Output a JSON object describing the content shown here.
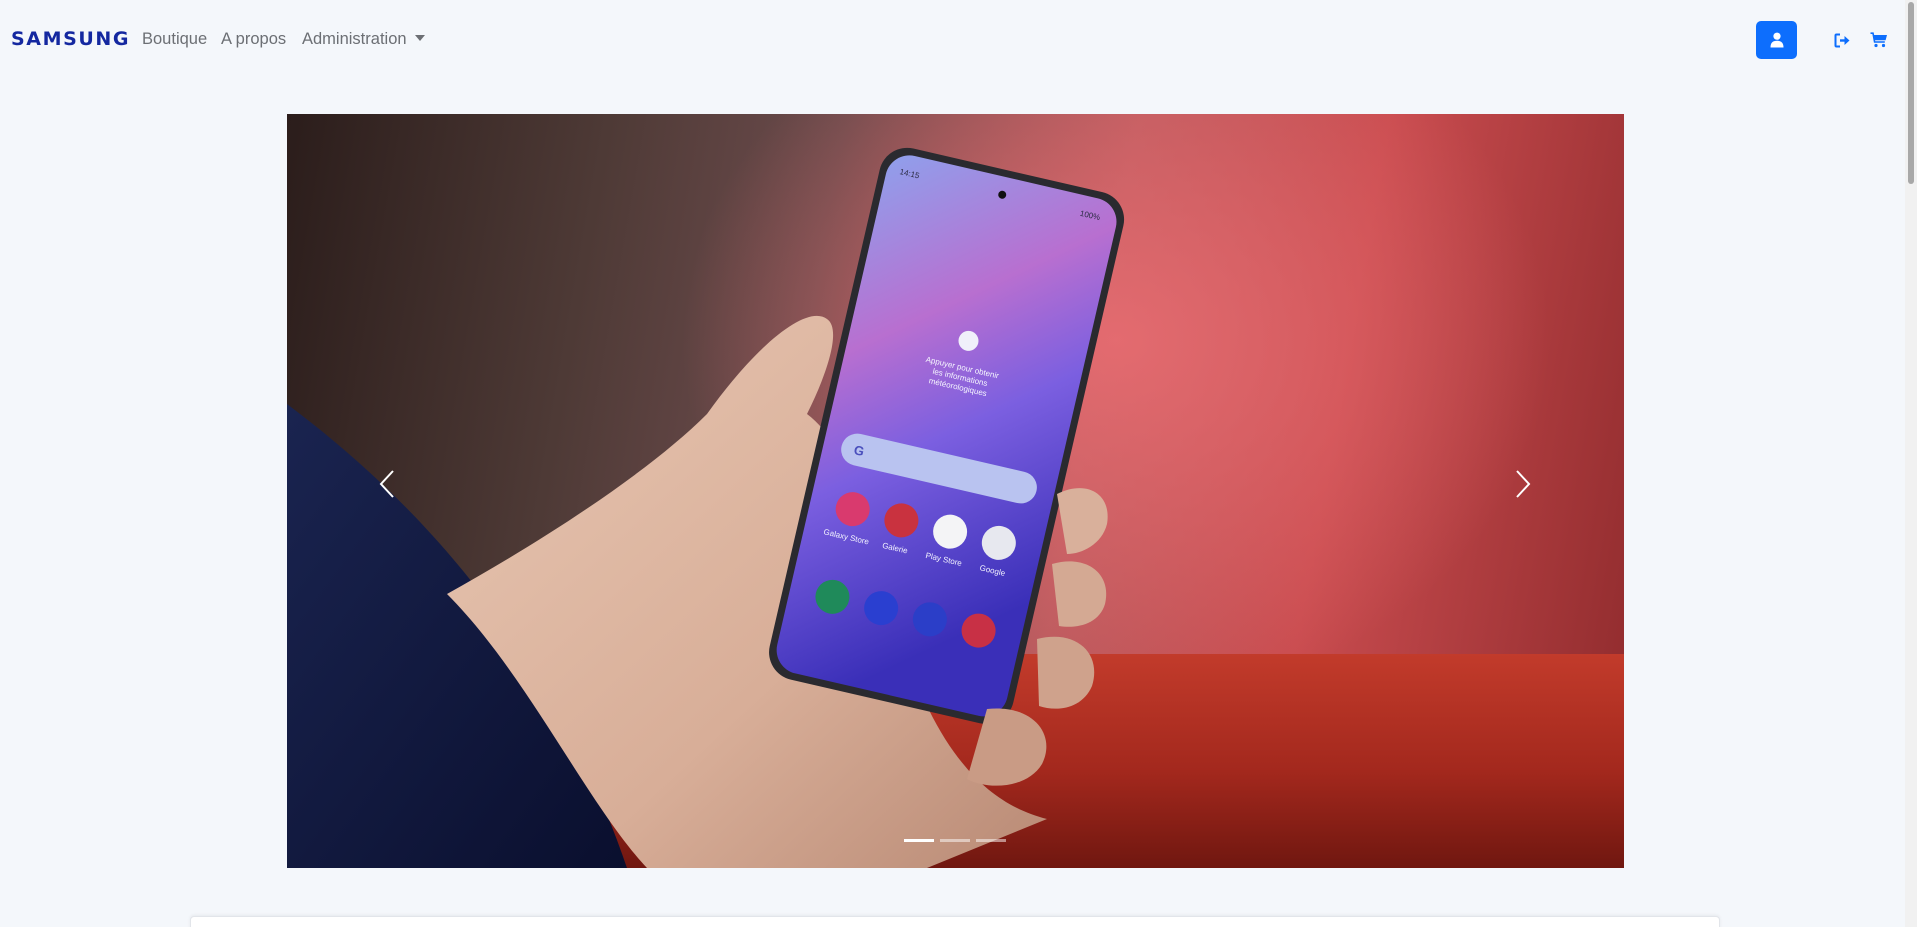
{
  "navbar": {
    "brand": "SAMSUNG",
    "links": {
      "boutique": "Boutique",
      "apropos": "A propos",
      "administration": "Administration"
    },
    "icons": [
      "user-icon",
      "logout-icon",
      "cart-icon"
    ],
    "accent_color": "#0d6efd",
    "brand_color": "#1428a0"
  },
  "carousel": {
    "slide_count": 3,
    "active_index": 0,
    "phone_screen": {
      "status_time": "14:15",
      "status_battery": "100%",
      "weather_widget": "Appuyer pour obtenir les informations météorologiques",
      "apps": [
        "Galaxy Store",
        "Galerie",
        "Play Store",
        "Google"
      ]
    }
  }
}
